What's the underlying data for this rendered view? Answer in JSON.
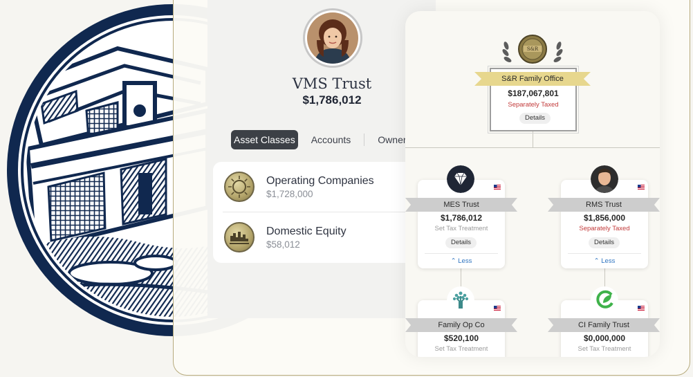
{
  "entity": {
    "name": "VMS Trust",
    "value": "$1,786,012"
  },
  "tabs": [
    "Asset Classes",
    "Accounts",
    "Owner"
  ],
  "assets": [
    {
      "name": "Operating Companies",
      "value": "$1,728,000"
    },
    {
      "name": "Domestic Equity",
      "value": "$58,012"
    }
  ],
  "org": {
    "root": {
      "name": "S&R Family Office",
      "value": "$187,067,801",
      "tax": "Separately Taxed",
      "details": "Details",
      "seal_text": "S&R"
    },
    "nodes": [
      {
        "name": "MES Trust",
        "value": "$1,786,012",
        "tax": "Set Tax Treatment",
        "details": "Details",
        "less": "Less"
      },
      {
        "name": "RMS Trust",
        "value": "$1,856,000",
        "tax": "Separately Taxed",
        "details": "Details",
        "less": "Less"
      },
      {
        "name": "Family Op Co",
        "value": "$520,100",
        "tax": "Set Tax Treatment"
      },
      {
        "name": "CI Family Trust",
        "value": "$0,000,000",
        "tax": "Set Tax Treatment"
      }
    ]
  },
  "colors": {
    "navy": "#10284f",
    "gold_frame": "#b6aa7c",
    "gold_ribbon": "#e7d78e",
    "red_tax": "#c23a3a",
    "link_blue": "#2f74c0"
  }
}
